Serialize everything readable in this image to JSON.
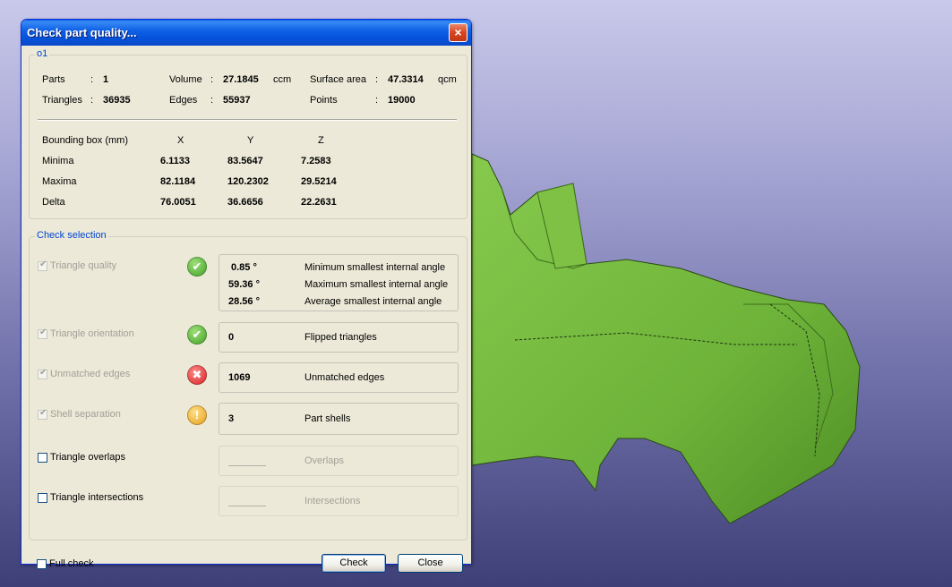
{
  "window": {
    "title": "Check part quality...",
    "close_label": "×"
  },
  "stats": {
    "group_label": "o1",
    "parts_label": "Parts",
    "parts": "1",
    "volume_label": "Volume",
    "volume": "27.1845",
    "volume_unit": "ccm",
    "surface_label": "Surface area",
    "surface": "47.3314",
    "surface_unit": "qcm",
    "triangles_label": "Triangles",
    "triangles": "36935",
    "edges_label": "Edges",
    "edges": "55937",
    "points_label": "Points",
    "points": "19000",
    "colon": ":"
  },
  "bbox": {
    "header": "Bounding box (mm)",
    "cols": [
      "X",
      "Y",
      "Z"
    ],
    "rows": [
      {
        "label": "Minima",
        "x": "6.1133",
        "y": "83.5647",
        "z": "7.2583"
      },
      {
        "label": "Maxima",
        "x": "82.1184",
        "y": "120.2302",
        "z": "29.5214"
      },
      {
        "label": "Delta",
        "x": "76.0051",
        "y": "36.6656",
        "z": "22.2631"
      }
    ]
  },
  "checks": {
    "group_label": "Check selection",
    "triangle_quality": {
      "label": "Triangle quality",
      "values": [
        "0.85 °",
        "59.36 °",
        "28.56 °"
      ],
      "descs": [
        "Minimum smallest internal angle",
        "Maximum smallest internal angle",
        "Average smallest internal angle"
      ]
    },
    "triangle_orientation": {
      "label": "Triangle orientation",
      "value": "0",
      "desc": "Flipped triangles"
    },
    "unmatched_edges": {
      "label": "Unmatched edges",
      "value": "1069",
      "desc": "Unmatched edges"
    },
    "shell_separation": {
      "label": "Shell separation",
      "value": "3",
      "desc": "Part shells"
    },
    "triangle_overlaps": {
      "label": "Triangle overlaps",
      "desc": "Overlaps"
    },
    "triangle_intersections": {
      "label": "Triangle intersections",
      "desc": "Intersections"
    }
  },
  "footer": {
    "full_check_label": "Full check",
    "check_button": "Check",
    "close_button": "Close"
  },
  "colors": {
    "model_green": "#6fb43a",
    "ok": "#3c9d20",
    "error": "#d11e1e",
    "warning": "#e49a12"
  },
  "icons": {
    "ok": "✔",
    "error": "✖",
    "warning": "!",
    "check": "✔"
  }
}
